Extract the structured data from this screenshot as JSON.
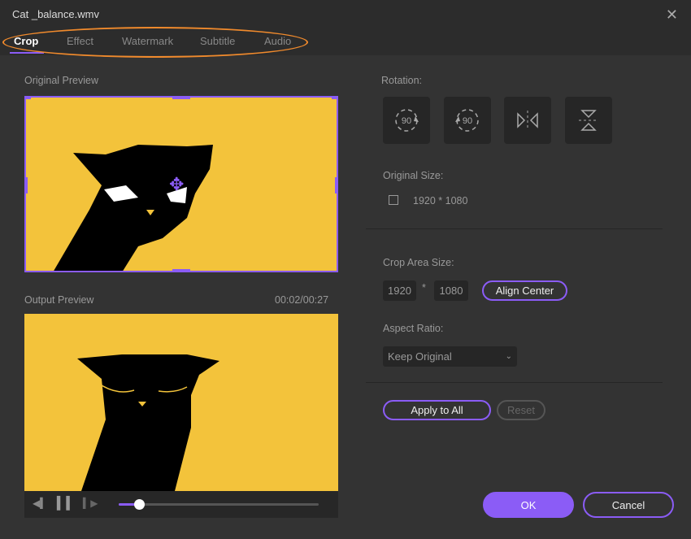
{
  "window": {
    "title": "Cat _balance.wmv"
  },
  "tabs": [
    {
      "label": "Crop",
      "active": true
    },
    {
      "label": "Effect"
    },
    {
      "label": "Watermark"
    },
    {
      "label": "Subtitle"
    },
    {
      "label": "Audio"
    }
  ],
  "original_preview": {
    "label": "Original Preview"
  },
  "output_preview": {
    "label": "Output Preview",
    "time": "00:02/00:27"
  },
  "playback": {
    "progress_percent": 10
  },
  "rotation": {
    "label": "Rotation:",
    "buttons": [
      "rotate-right-90",
      "rotate-left-90",
      "flip-horizontal",
      "flip-vertical"
    ],
    "rot_text": "90"
  },
  "original_size": {
    "label": "Original Size:",
    "value": "1920 * 1080"
  },
  "crop_area": {
    "label": "Crop Area Size:",
    "width": "1920",
    "sep": "*",
    "height": "1080",
    "align_center": "Align Center"
  },
  "aspect_ratio": {
    "label": "Aspect Ratio:",
    "value": "Keep Original"
  },
  "actions": {
    "apply_all": "Apply to All",
    "reset": "Reset",
    "ok": "OK",
    "cancel": "Cancel"
  },
  "colors": {
    "accent": "#8b5cf6",
    "video_bg": "#f3c33b",
    "annotation": "#f08a2c"
  }
}
